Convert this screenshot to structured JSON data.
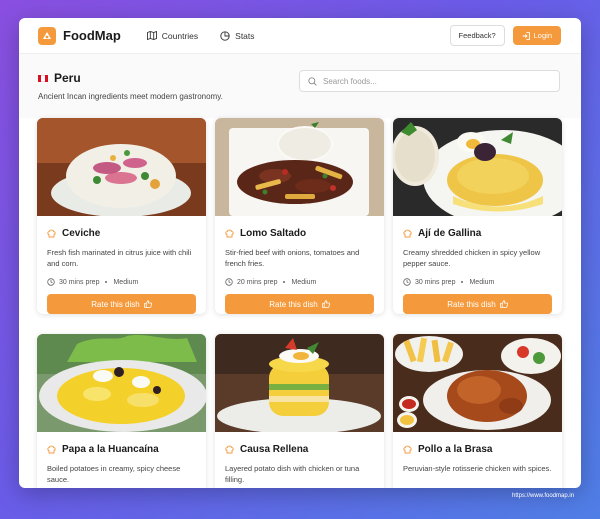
{
  "app": {
    "brand": "FoodMap",
    "nav": [
      {
        "label": "Countries",
        "icon": "map-icon"
      },
      {
        "label": "Stats",
        "icon": "pie-chart-icon"
      }
    ],
    "feedback_label": "Feedback?",
    "login_label": "Login",
    "accent": "#f59a3c"
  },
  "country": {
    "name": "Peru",
    "tagline": "Ancient Incan ingredients meet modern gastronomy.",
    "flag_colors": [
      "#d91023",
      "#ffffff",
      "#d91023"
    ]
  },
  "search": {
    "placeholder": "Search foods...",
    "value": ""
  },
  "dishes": [
    {
      "name": "Ceviche",
      "description": "Fresh fish marinated in citrus juice with chili and corn.",
      "prep": "30 mins prep",
      "difficulty": "Medium",
      "rate_label": "Rate this dish"
    },
    {
      "name": "Lomo Saltado",
      "description": "Stir-fried beef with onions, tomatoes and french fries.",
      "prep": "20 mins prep",
      "difficulty": "Medium",
      "rate_label": "Rate this dish"
    },
    {
      "name": "Ají de Gallina",
      "description": "Creamy shredded chicken in spicy yellow pepper sauce.",
      "prep": "30 mins prep",
      "difficulty": "Medium",
      "rate_label": "Rate this dish"
    },
    {
      "name": "Papa a la Huancaína",
      "description": "Boiled potatoes in creamy, spicy cheese sauce.",
      "prep": "",
      "difficulty": "",
      "rate_label": ""
    },
    {
      "name": "Causa Rellena",
      "description": "Layered potato dish with chicken or tuna filling.",
      "prep": "",
      "difficulty": "",
      "rate_label": ""
    },
    {
      "name": "Pollo a la Brasa",
      "description": "Peruvian-style rotisserie chicken with spices.",
      "prep": "",
      "difficulty": "",
      "rate_label": ""
    }
  ],
  "footer_url": "https://www.foodmap.in"
}
